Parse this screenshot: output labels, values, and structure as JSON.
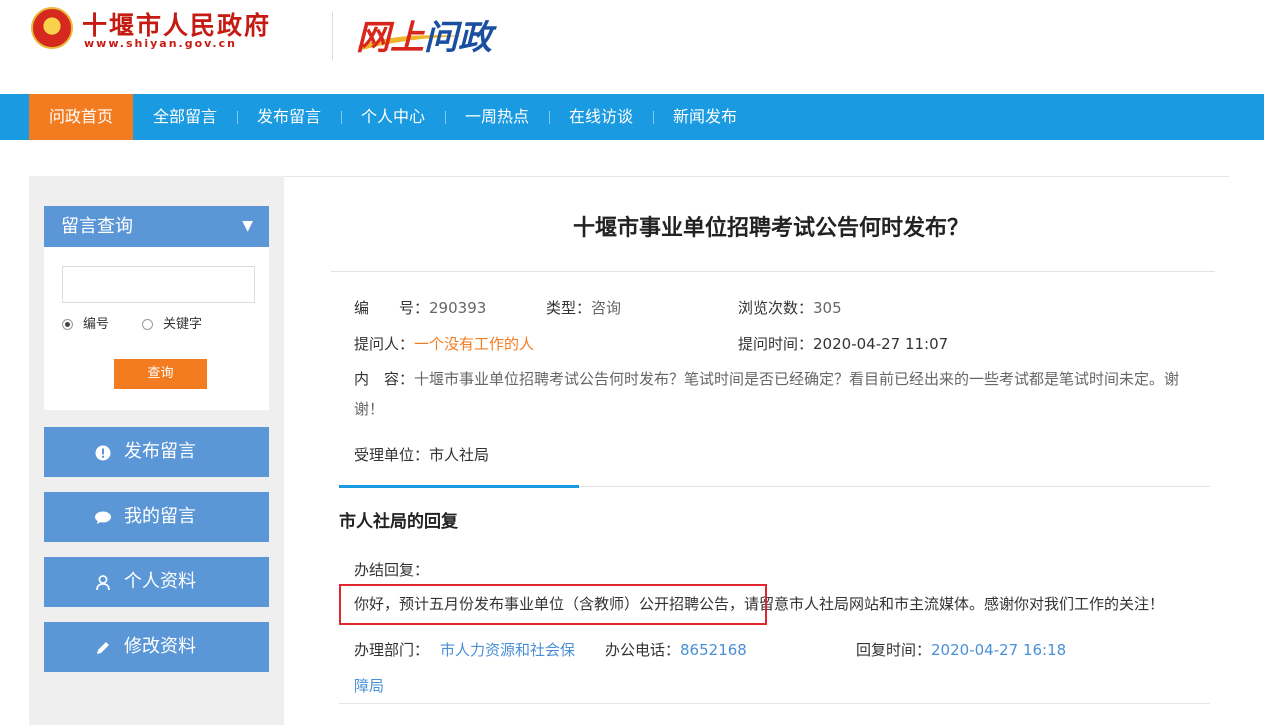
{
  "header": {
    "site_name": "十堰市人民政府",
    "site_url": "www.shiyan.gov.cn",
    "logo_text_1": "网上",
    "logo_text_2": "问政"
  },
  "nav": {
    "items": [
      {
        "label": "问政首页",
        "active": true
      },
      {
        "label": "全部留言",
        "active": false
      },
      {
        "label": "发布留言",
        "active": false
      },
      {
        "label": "个人中心",
        "active": false
      },
      {
        "label": "一周热点",
        "active": false
      },
      {
        "label": "在线访谈",
        "active": false
      },
      {
        "label": "新闻发布",
        "active": false
      }
    ]
  },
  "sidebar": {
    "query": {
      "title": "留言查询",
      "input_value": "",
      "radio_number": "编号",
      "radio_keyword": "关键字",
      "selected": "编号",
      "button": "查询"
    },
    "buttons": [
      {
        "label": "发布留言",
        "icon": "exclamation-icon"
      },
      {
        "label": "我的留言",
        "icon": "speech-bubble-icon"
      },
      {
        "label": "个人资料",
        "icon": "person-icon"
      },
      {
        "label": "修改资料",
        "icon": "pencil-icon"
      }
    ]
  },
  "question": {
    "title": "十堰市事业单位招聘考试公告何时发布？",
    "number_label": "编　　号：",
    "number": "290393",
    "type_label": "类型：",
    "type": "咨询",
    "views_label": "浏览次数：",
    "views": "305",
    "asker_label": "提问人：",
    "asker": "一个没有工作的人",
    "time_label": "提问时间：",
    "time": "2020-04-27 11:07",
    "content_label": "内　容：",
    "content": "十堰市事业单位招聘考试公告何时发布？笔试时间是否已经确定？看目前已经出来的一些考试都是笔试时间未定。谢谢！",
    "dept_label": "受理单位：",
    "dept": "市人社局"
  },
  "reply": {
    "title": "市人社局的回复",
    "status": "办结回复：",
    "body": "你好，预计五月份发布事业单位（含教师）公开招聘公告，请留意市人社局网站和市主流媒体。感谢你对我们工作的关注！",
    "office_label": "办理部门：",
    "office_line1": "市人力资源和社会保",
    "office_line2": "障局",
    "phone_label": "办公电话：",
    "phone": "8652168",
    "reply_time_label": "回复时间：",
    "reply_time": "2020-04-27 16:18"
  },
  "colors": {
    "nav_blue": "#1a9ae0",
    "accent_orange": "#f47c20",
    "side_blue": "#5b97d6",
    "highlight_red": "#e0262e"
  }
}
